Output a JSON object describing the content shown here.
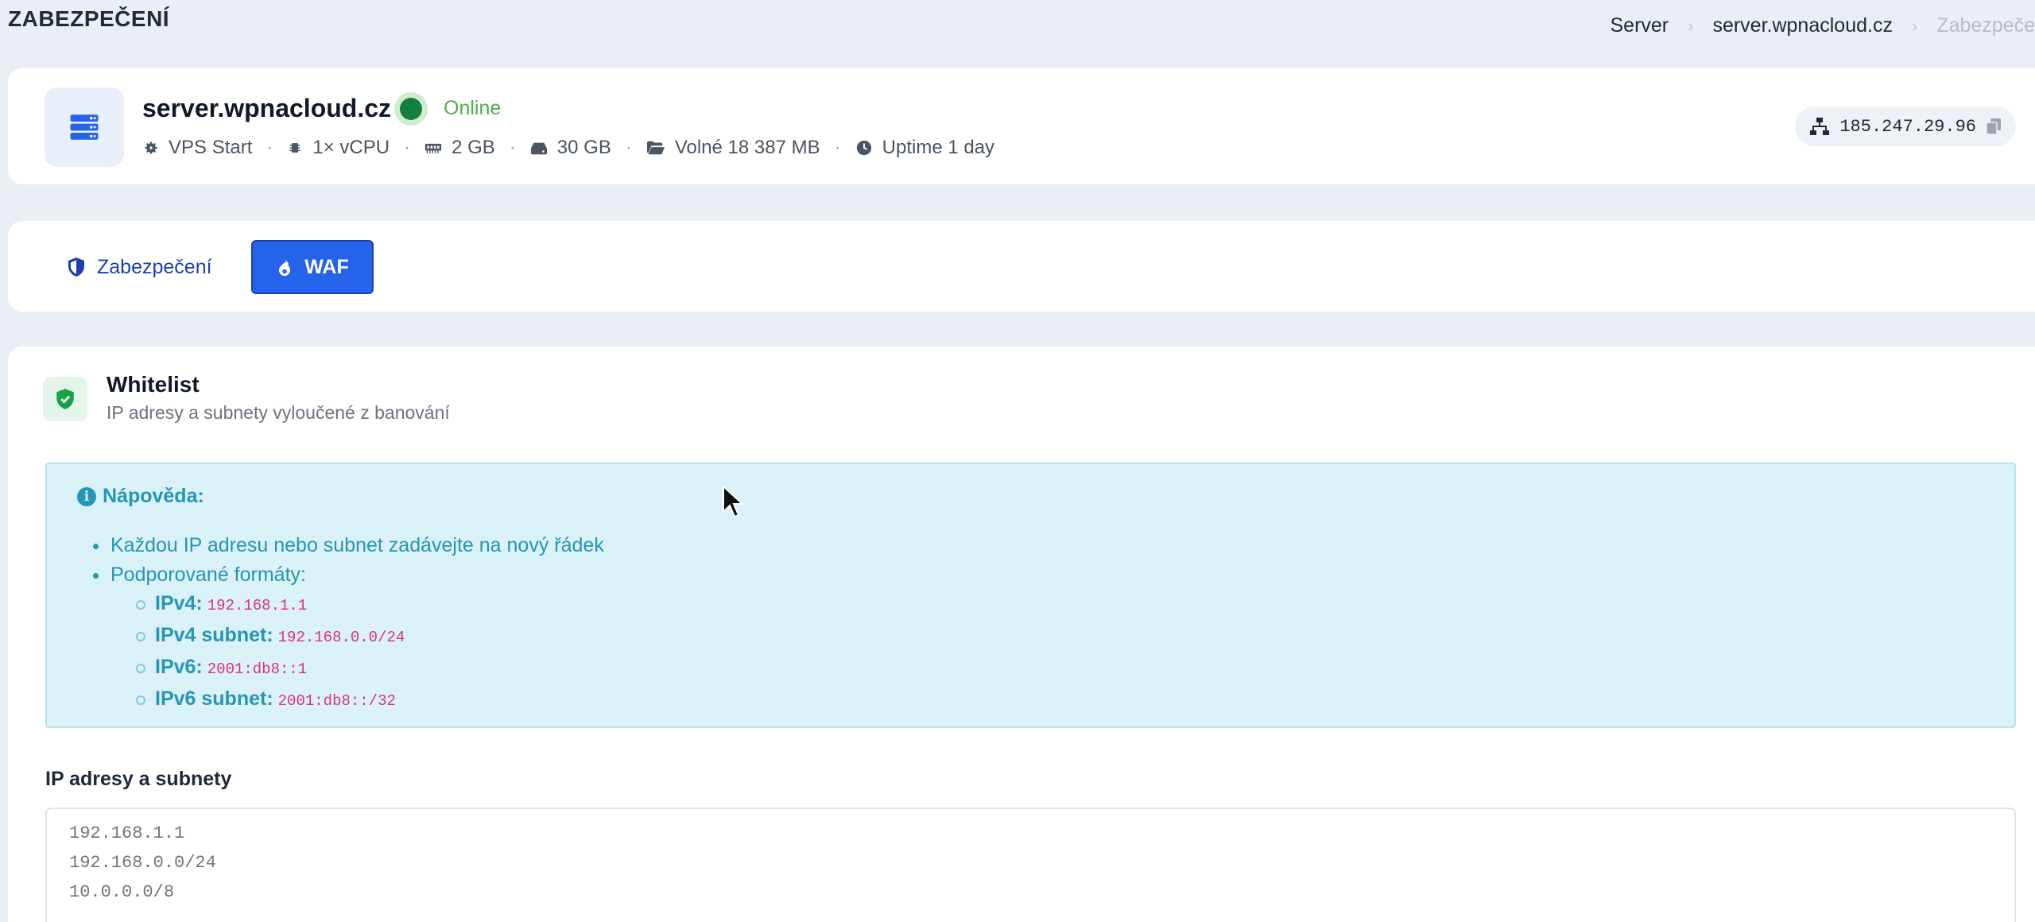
{
  "header": {
    "page_title": "ZABEZPEČENÍ",
    "breadcrumb": [
      "Server",
      "server.wpnacloud.cz",
      "Zabezpeče"
    ]
  },
  "server": {
    "icon": "server-icon",
    "name": "server.wpnacloud.cz",
    "status": "Online",
    "status_color": "#15803d",
    "specs": {
      "plan": "VPS Start",
      "cpu": "1× vCPU",
      "ram": "2 GB",
      "disk": "30 GB",
      "free": "Volné 18 387 MB",
      "uptime": "Uptime 1 day"
    },
    "ip": "185.247.29.96"
  },
  "tabs": {
    "security": "Zabezpečení",
    "waf": "WAF",
    "active": "waf",
    "accent": "#2563eb"
  },
  "whitelist": {
    "title": "Whitelist",
    "subtitle": "IP adresy a subnety vyloučené z banování",
    "help": {
      "title": "Nápověda:",
      "items": [
        "Každou IP adresu nebo subnet zadávejte na nový řádek",
        "Podporované formáty:"
      ],
      "formats": [
        {
          "label": "IPv4:",
          "example": "192.168.1.1"
        },
        {
          "label": "IPv4 subnet:",
          "example": "192.168.0.0/24"
        },
        {
          "label": "IPv6:",
          "example": "2001:db8::1"
        },
        {
          "label": "IPv6 subnet:",
          "example": "2001:db8::/32"
        }
      ]
    },
    "field_label": "IP adresy a subnety",
    "placeholder": "192.168.1.1\n192.168.0.0/24\n10.0.0.0/8"
  }
}
